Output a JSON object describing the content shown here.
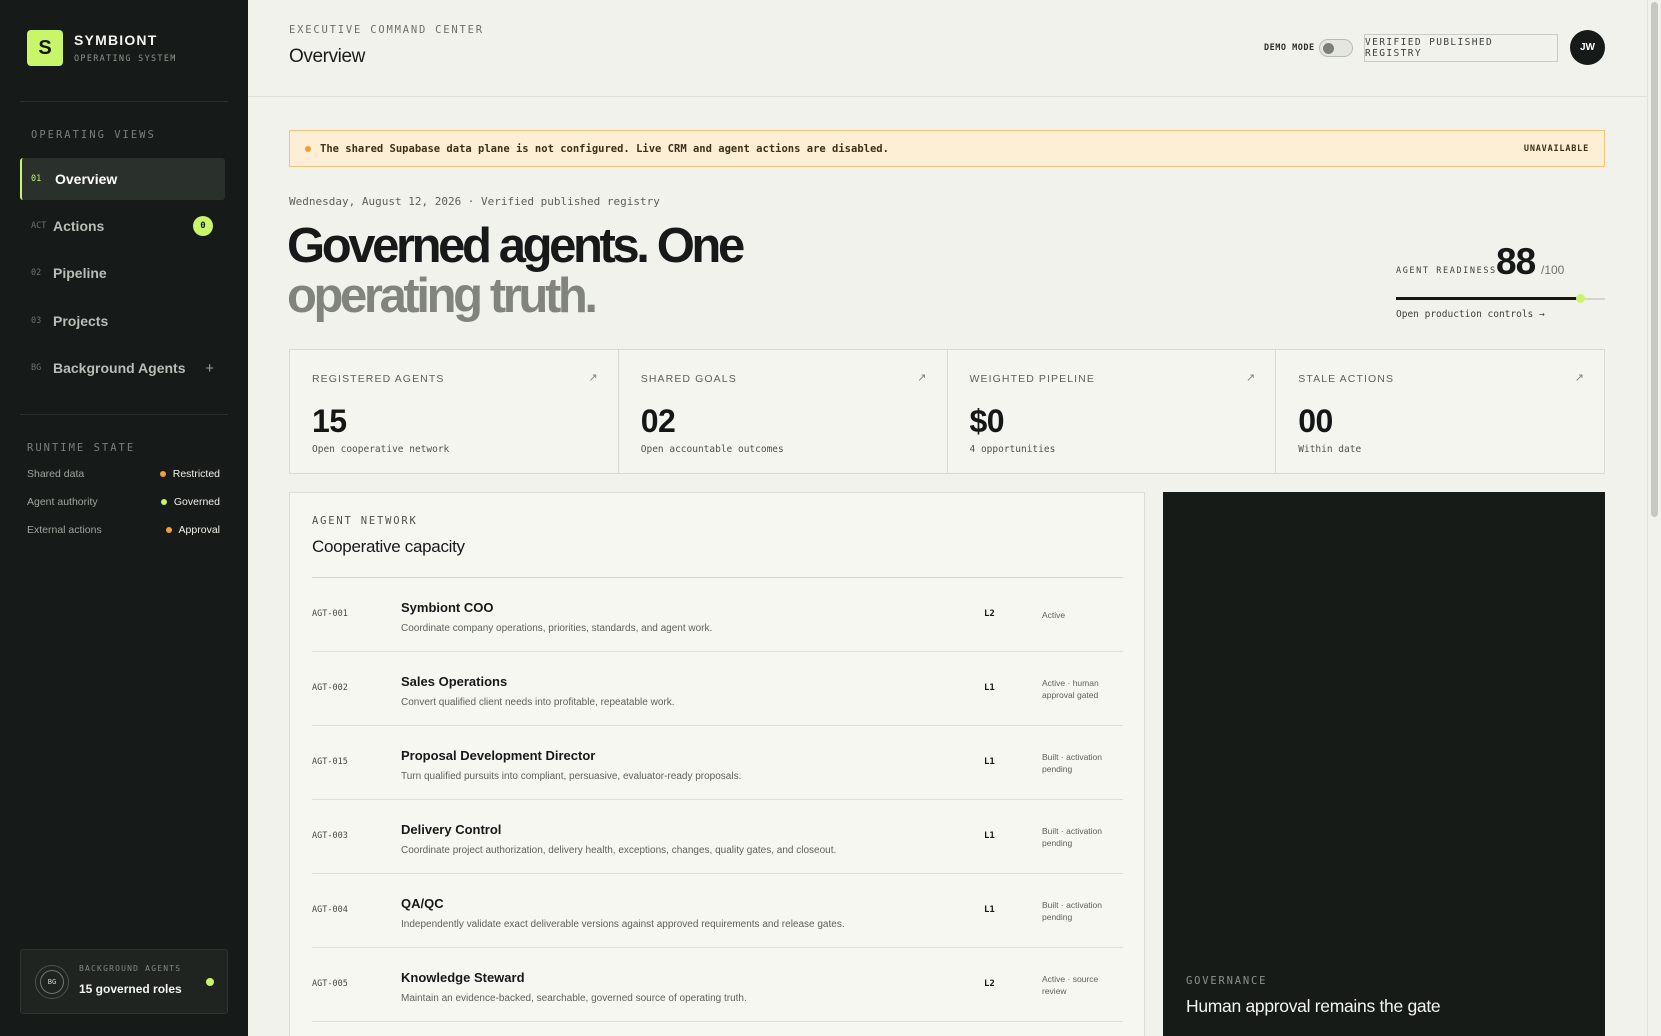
{
  "brand": {
    "mark": "S",
    "name": "SYMBIONT",
    "subtitle": "OPERATING SYSTEM"
  },
  "sidebar": {
    "section_label": "OPERATING VIEWS",
    "items": [
      {
        "code": "01",
        "label": "Overview",
        "active": true
      },
      {
        "code": "ACT",
        "label": "Actions",
        "badge": "0"
      },
      {
        "code": "02",
        "label": "Pipeline"
      },
      {
        "code": "03",
        "label": "Projects"
      },
      {
        "code": "BG",
        "label": "Background Agents",
        "action": "+"
      }
    ],
    "runtime_label": "RUNTIME STATE",
    "runtime": [
      {
        "label": "Shared data",
        "value": "Restricted",
        "color": "#f1a131"
      },
      {
        "label": "Agent authority",
        "value": "Governed",
        "color": "#c8f56a"
      },
      {
        "label": "External actions",
        "value": "Approval",
        "color": "#f1a131"
      }
    ],
    "bg_card": {
      "icon_text": "BG",
      "label": "BACKGROUND AGENTS",
      "value": "15 governed roles"
    }
  },
  "header": {
    "eyebrow": "EXECUTIVE COMMAND CENTER",
    "title": "Overview",
    "demo_label": "DEMO MODE",
    "registry_button": "VERIFIED PUBLISHED REGISTRY",
    "avatar": "JW"
  },
  "alert": {
    "text": "The shared Supabase data plane is not configured. Live CRM and agent actions are disabled.",
    "status": "UNAVAILABLE",
    "color": "#f1a131"
  },
  "date_line": "Wednesday, August 12, 2026 · Verified published registry",
  "hero": {
    "line1": "Governed agents. One",
    "line2": "operating truth."
  },
  "readiness": {
    "label": "AGENT READINESS",
    "value": "88",
    "max": "/100",
    "fraction": 0.88,
    "link": "Open production controls →"
  },
  "stats": [
    {
      "label": "REGISTERED AGENTS",
      "value": "15",
      "sub": "Open cooperative network",
      "arrow": "↗"
    },
    {
      "label": "SHARED GOALS",
      "value": "02",
      "sub": "Open accountable outcomes",
      "arrow": "↗"
    },
    {
      "label": "WEIGHTED PIPELINE",
      "value": "$0",
      "sub": "4 opportunities",
      "arrow": "↗"
    },
    {
      "label": "STALE ACTIONS",
      "value": "00",
      "sub": "Within date",
      "arrow": "↗"
    }
  ],
  "agent_network": {
    "eyebrow": "AGENT NETWORK",
    "title": "Cooperative capacity",
    "agents": [
      {
        "id": "AGT-001",
        "name": "Symbiont COO",
        "desc": "Coordinate company operations, priorities, standards, and agent work.",
        "level": "L2",
        "status": "Active"
      },
      {
        "id": "AGT-002",
        "name": "Sales Operations",
        "desc": "Convert qualified client needs into profitable, repeatable work.",
        "level": "L1",
        "status": "Active · human approval gated"
      },
      {
        "id": "AGT-015",
        "name": "Proposal Development Director",
        "desc": "Turn qualified pursuits into compliant, persuasive, evaluator-ready proposals.",
        "level": "L1",
        "status": "Built · activation pending"
      },
      {
        "id": "AGT-003",
        "name": "Delivery Control",
        "desc": "Coordinate project authorization, delivery health, exceptions, changes, quality gates, and closeout.",
        "level": "L1",
        "status": "Built · activation pending"
      },
      {
        "id": "AGT-004",
        "name": "QA/QC",
        "desc": "Independently validate exact deliverable versions against approved requirements and release gates.",
        "level": "L1",
        "status": "Built · activation pending"
      },
      {
        "id": "AGT-005",
        "name": "Knowledge Steward",
        "desc": "Maintain an evidence-backed, searchable, governed source of operating truth.",
        "level": "L2",
        "status": "Active · source review"
      }
    ]
  },
  "governance": {
    "eyebrow": "GOVERNANCE",
    "title": "Human approval remains the gate"
  },
  "colors": {
    "accent": "#c8f56a",
    "sidebar_bg": "#161a18",
    "page_bg": "#f2f2ed",
    "alert_bg": "#fcefd6"
  }
}
